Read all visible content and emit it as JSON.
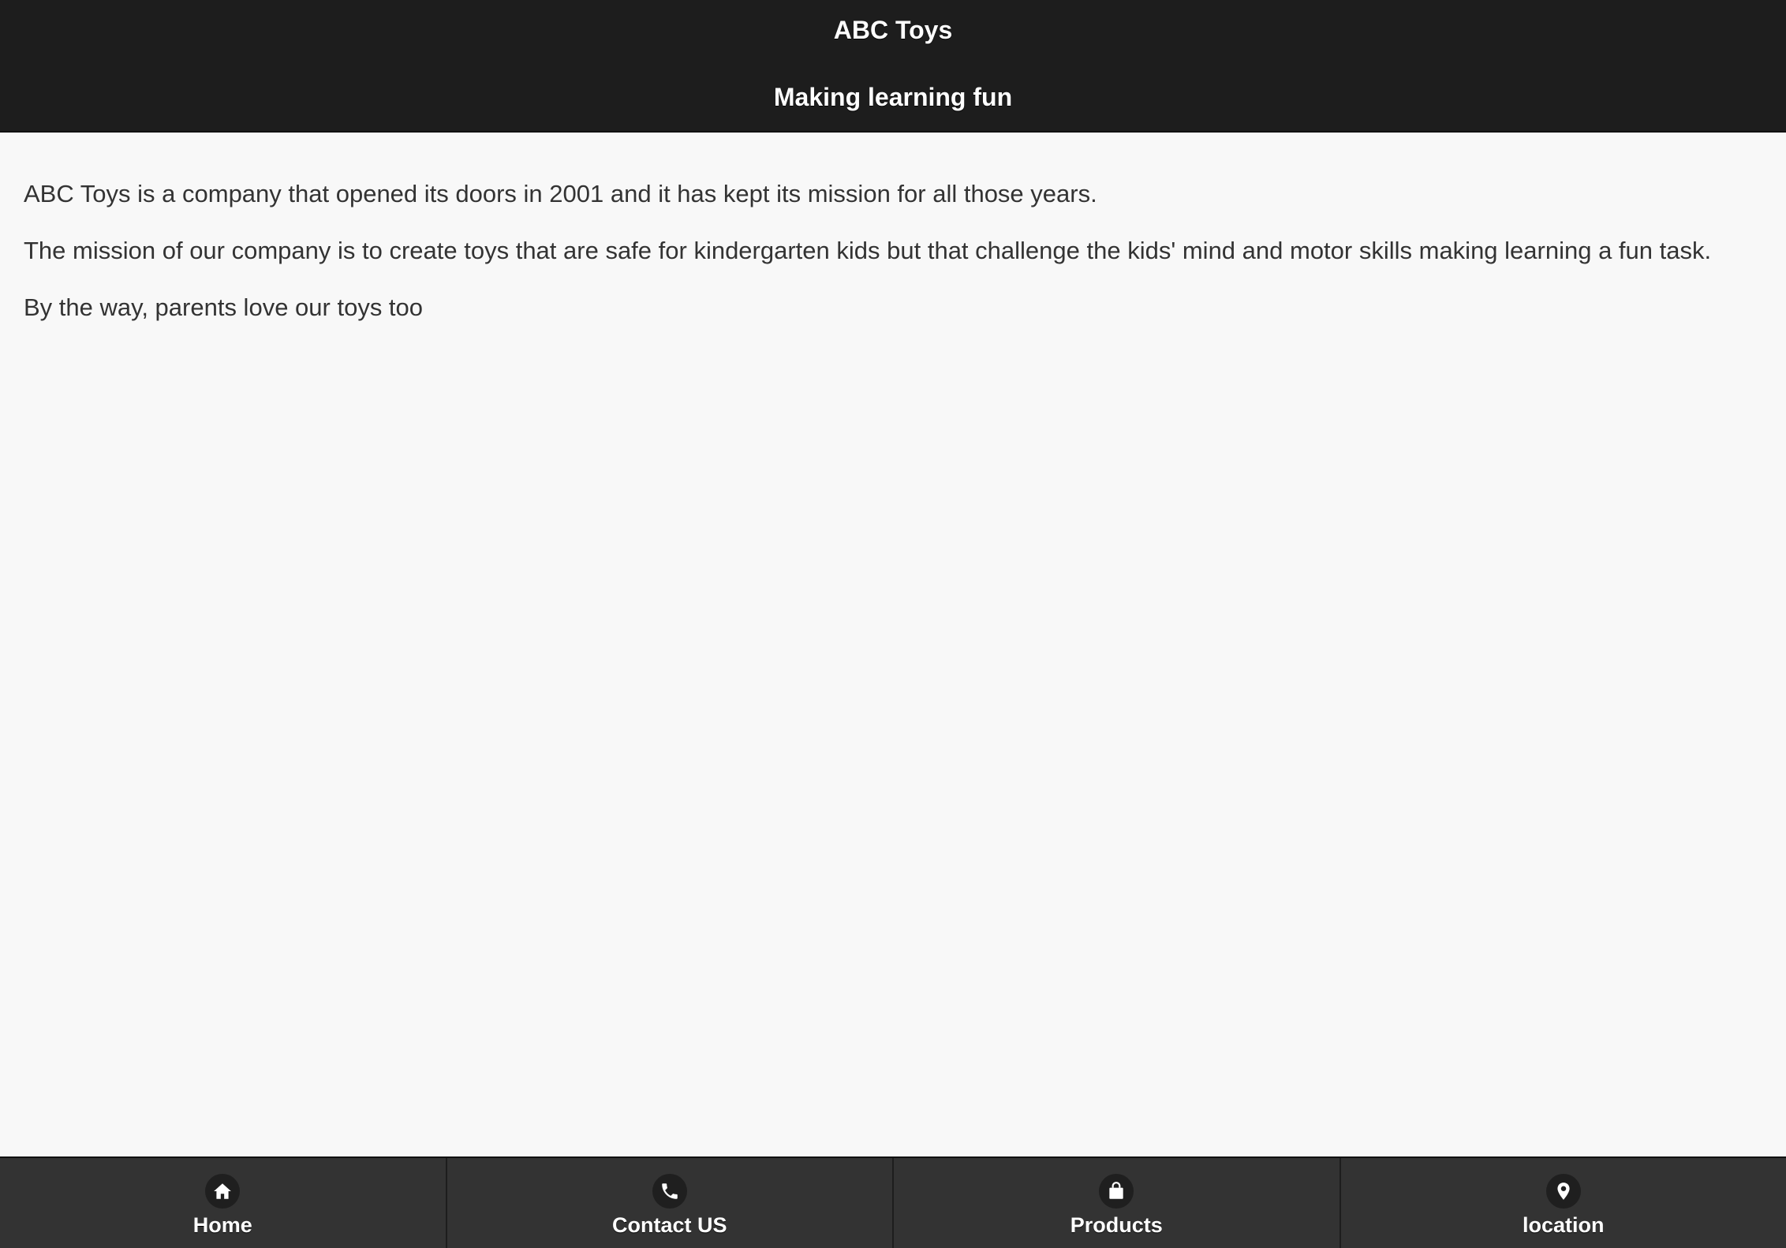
{
  "header": {
    "title": "ABC Toys",
    "subtitle": "Making learning fun"
  },
  "content": {
    "paragraphs": [
      "ABC Toys is a company that opened its doors in 2001 and it has kept its mission for all those years.",
      "The mission of our company is to create toys that are safe for kindergarten kids but that challenge the kids' mind and motor skills making learning a fun task.",
      "By the way, parents love our toys too"
    ]
  },
  "navbar": {
    "items": [
      {
        "label": "Home",
        "icon": "home-icon"
      },
      {
        "label": "Contact US",
        "icon": "phone-icon"
      },
      {
        "label": "Products",
        "icon": "shopping-bag-icon"
      },
      {
        "label": "location",
        "icon": "location-pin-icon"
      }
    ]
  },
  "colors": {
    "header_bg": "#1d1d1d",
    "navbar_bg": "#333333",
    "page_bg": "#f8f8f8",
    "text": "#333333"
  }
}
